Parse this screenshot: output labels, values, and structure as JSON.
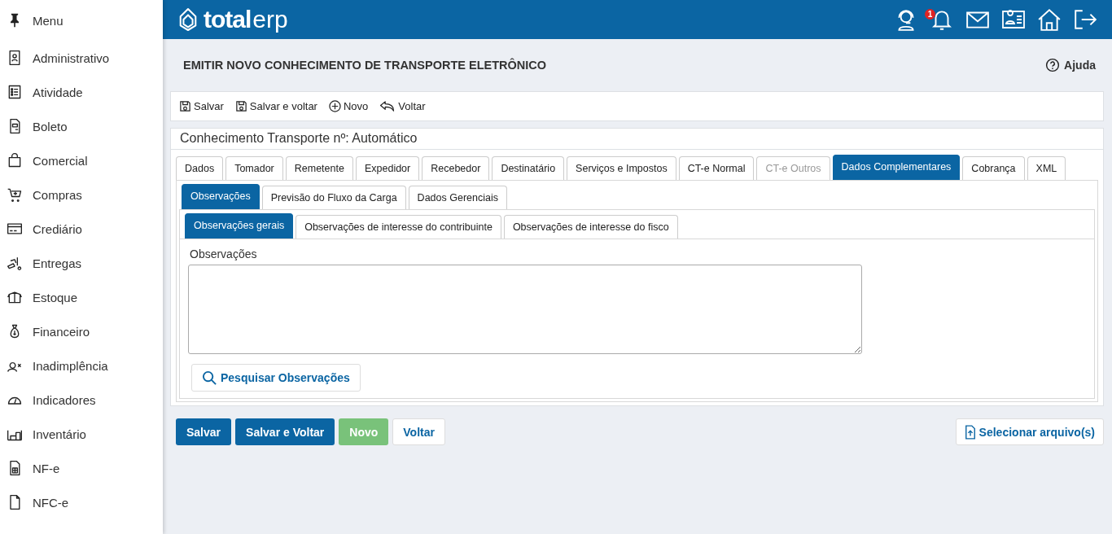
{
  "sidebar": {
    "title": "Menu",
    "items": [
      {
        "label": "Administrativo"
      },
      {
        "label": "Atividade"
      },
      {
        "label": "Boleto"
      },
      {
        "label": "Comercial"
      },
      {
        "label": "Compras"
      },
      {
        "label": "Crediário"
      },
      {
        "label": "Entregas"
      },
      {
        "label": "Estoque"
      },
      {
        "label": "Financeiro"
      },
      {
        "label": "Inadimplência"
      },
      {
        "label": "Indicadores"
      },
      {
        "label": "Inventário"
      },
      {
        "label": "NF-e"
      },
      {
        "label": "NFC-e"
      }
    ]
  },
  "header": {
    "logo_bold": "total",
    "logo_light": "erp",
    "notification_count": "1"
  },
  "page": {
    "title": "EMITIR NOVO CONHECIMENTO DE TRANSPORTE ELETRÔNICO",
    "help": "Ajuda"
  },
  "toolbar": [
    {
      "label": "Salvar",
      "kind": "save"
    },
    {
      "label": "Salvar e voltar",
      "kind": "save"
    },
    {
      "label": "Novo",
      "kind": "new"
    },
    {
      "label": "Voltar",
      "kind": "back"
    }
  ],
  "form": {
    "title": "Conhecimento Transporte nº: Automático",
    "tabs": [
      {
        "label": "Dados",
        "selected": false,
        "disabled": false
      },
      {
        "label": "Tomador",
        "selected": false,
        "disabled": false
      },
      {
        "label": "Remetente",
        "selected": false,
        "disabled": false
      },
      {
        "label": "Expedidor",
        "selected": false,
        "disabled": false
      },
      {
        "label": "Recebedor",
        "selected": false,
        "disabled": false
      },
      {
        "label": "Destinatário",
        "selected": false,
        "disabled": false
      },
      {
        "label": "Serviços e Impostos",
        "selected": false,
        "disabled": false
      },
      {
        "label": "CT-e Normal",
        "selected": false,
        "disabled": false
      },
      {
        "label": "CT-e Outros",
        "selected": false,
        "disabled": true
      },
      {
        "label": "Dados Complementares",
        "selected": true,
        "disabled": false
      },
      {
        "label": "Cobrança",
        "selected": false,
        "disabled": false
      },
      {
        "label": "XML",
        "selected": false,
        "disabled": false
      }
    ],
    "subtabs": [
      {
        "label": "Observações",
        "selected": true
      },
      {
        "label": "Previsão do Fluxo da Carga",
        "selected": false
      },
      {
        "label": "Dados Gerenciais",
        "selected": false
      }
    ],
    "subsubtabs": [
      {
        "label": "Observações gerais",
        "selected": true
      },
      {
        "label": "Observações de interesse do contribuinte",
        "selected": false
      },
      {
        "label": "Observações de interesse do fisco",
        "selected": false
      }
    ],
    "field_label": "Observações",
    "search_button": "Pesquisar Observações"
  },
  "actions": [
    {
      "label": "Salvar",
      "kind": "primary"
    },
    {
      "label": "Salvar e Voltar",
      "kind": "primary"
    },
    {
      "label": "Novo",
      "kind": "success"
    },
    {
      "label": "Voltar",
      "kind": "default"
    }
  ],
  "file_button": "Selecionar arquivo(s)"
}
